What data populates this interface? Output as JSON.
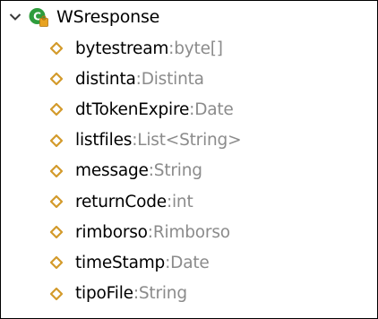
{
  "tree": {
    "root": {
      "label": "WSresponse",
      "expanded": true,
      "icon": "class-icon"
    },
    "fields": [
      {
        "name": "bytestream",
        "type": "byte[]",
        "icon": "field-icon"
      },
      {
        "name": "distinta",
        "type": "Distinta",
        "icon": "field-icon"
      },
      {
        "name": "dtTokenExpire",
        "type": "Date",
        "icon": "field-icon"
      },
      {
        "name": "listfiles",
        "type": "List<String>",
        "icon": "field-icon"
      },
      {
        "name": "message",
        "type": "String",
        "icon": "field-icon"
      },
      {
        "name": "returnCode",
        "type": "int",
        "icon": "field-icon"
      },
      {
        "name": "rimborso",
        "type": "Rimborso",
        "icon": "field-icon"
      },
      {
        "name": "timeStamp",
        "type": "Date",
        "icon": "field-icon"
      },
      {
        "name": "tipoFile",
        "type": "String",
        "icon": "field-icon"
      }
    ],
    "separator": " : "
  },
  "colors": {
    "field_icon": "#d39a2b",
    "class_icon": "#2e9c3c",
    "class_icon_badge": "#e8a321",
    "type_text": "#8b8b8b"
  }
}
